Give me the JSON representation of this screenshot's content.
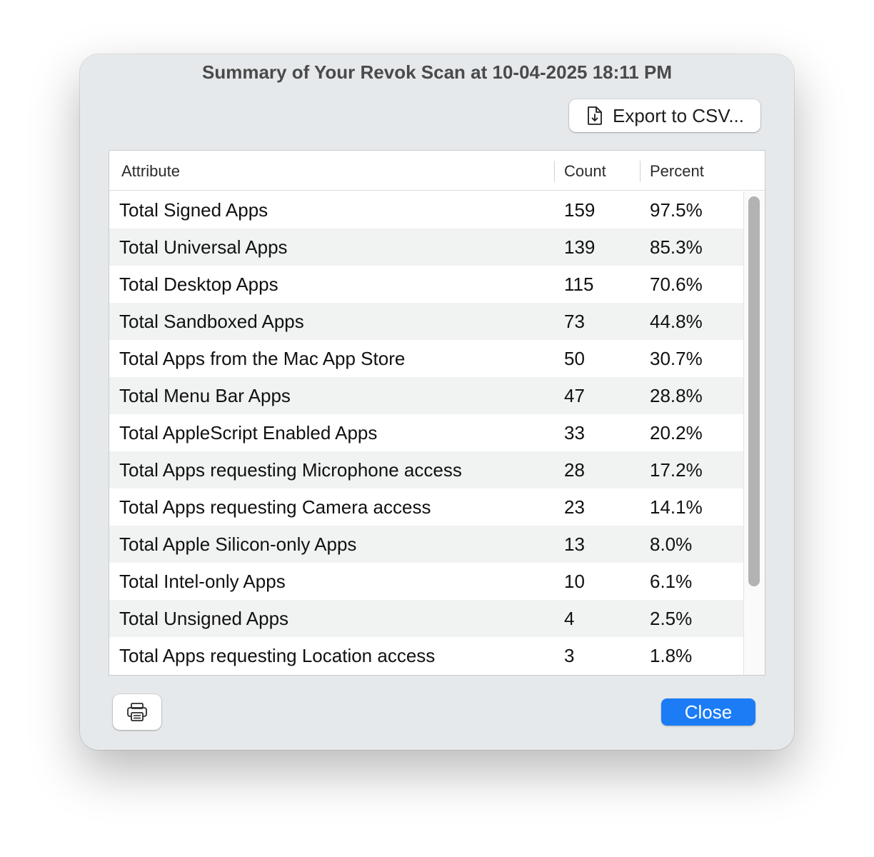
{
  "window": {
    "title": "Summary of Your Revok Scan at 10-04-2025 18:11 PM"
  },
  "toolbar": {
    "export_label": "Export to CSV...",
    "export_icon": "document-download-icon"
  },
  "table": {
    "columns": [
      "Attribute",
      "Count",
      "Percent"
    ],
    "rows": [
      {
        "attribute": "Total Signed Apps",
        "count": "159",
        "percent": "97.5%"
      },
      {
        "attribute": "Total Universal Apps",
        "count": "139",
        "percent": "85.3%"
      },
      {
        "attribute": "Total Desktop Apps",
        "count": "115",
        "percent": "70.6%"
      },
      {
        "attribute": "Total Sandboxed Apps",
        "count": "73",
        "percent": "44.8%"
      },
      {
        "attribute": "Total Apps from the Mac App Store",
        "count": "50",
        "percent": "30.7%"
      },
      {
        "attribute": "Total Menu Bar Apps",
        "count": "47",
        "percent": "28.8%"
      },
      {
        "attribute": "Total AppleScript Enabled Apps",
        "count": "33",
        "percent": "20.2%"
      },
      {
        "attribute": "Total Apps requesting Microphone access",
        "count": "28",
        "percent": "17.2%"
      },
      {
        "attribute": "Total Apps requesting Camera access",
        "count": "23",
        "percent": "14.1%"
      },
      {
        "attribute": "Total Apple Silicon-only Apps",
        "count": "13",
        "percent": "8.0%"
      },
      {
        "attribute": "Total Intel-only Apps",
        "count": "10",
        "percent": "6.1%"
      },
      {
        "attribute": "Total Unsigned Apps",
        "count": "4",
        "percent": "2.5%"
      },
      {
        "attribute": "Total Apps requesting Location access",
        "count": "3",
        "percent": "1.8%"
      }
    ]
  },
  "footer": {
    "print_icon": "printer-icon",
    "close_label": "Close"
  },
  "colors": {
    "accent": "#1b7cf6",
    "window_bg": "#e6e9eb",
    "row_alt": "#f1f2f2"
  }
}
